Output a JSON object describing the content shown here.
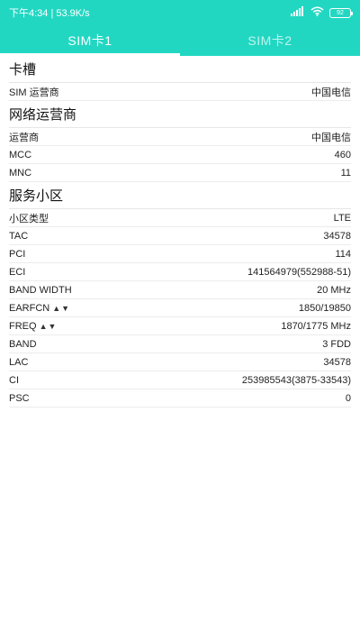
{
  "status_bar": {
    "time_speed": "下午4:34 | 53.9K/s",
    "signal_icon": "cellular-signal-icon",
    "wifi_icon": "wifi-icon",
    "battery_level": "92"
  },
  "tabs": [
    {
      "label": "SIM卡1",
      "active": true
    },
    {
      "label": "SIM卡2",
      "active": false
    }
  ],
  "sections": {
    "slot": {
      "title": "卡槽",
      "rows": [
        {
          "label": "SIM 运营商",
          "value": "中国电信"
        }
      ]
    },
    "operator": {
      "title": "网络运营商",
      "rows": [
        {
          "label": "运营商",
          "value": "中国电信"
        },
        {
          "label": "MCC",
          "value": "460"
        },
        {
          "label": "MNC",
          "value": "11"
        }
      ]
    },
    "cell": {
      "title": "服务小区",
      "rows": [
        {
          "label": "小区类型",
          "value": "LTE"
        },
        {
          "label": "TAC",
          "value": "34578"
        },
        {
          "label": "PCI",
          "value": "114"
        },
        {
          "label": "ECI",
          "value": "141564979(552988-51)"
        },
        {
          "label": "BAND WIDTH",
          "value": "20 MHz"
        },
        {
          "label": "EARFCN",
          "arrows": "▲▼",
          "value": "1850/19850"
        },
        {
          "label": "FREQ",
          "arrows": "▲▼",
          "value": "1870/1775 MHz"
        },
        {
          "label": "BAND",
          "value": "3 FDD"
        },
        {
          "label": "LAC",
          "value": "34578"
        },
        {
          "label": "CI",
          "value": "253985543(3875-33543)"
        },
        {
          "label": "PSC",
          "value": "0"
        }
      ]
    }
  }
}
